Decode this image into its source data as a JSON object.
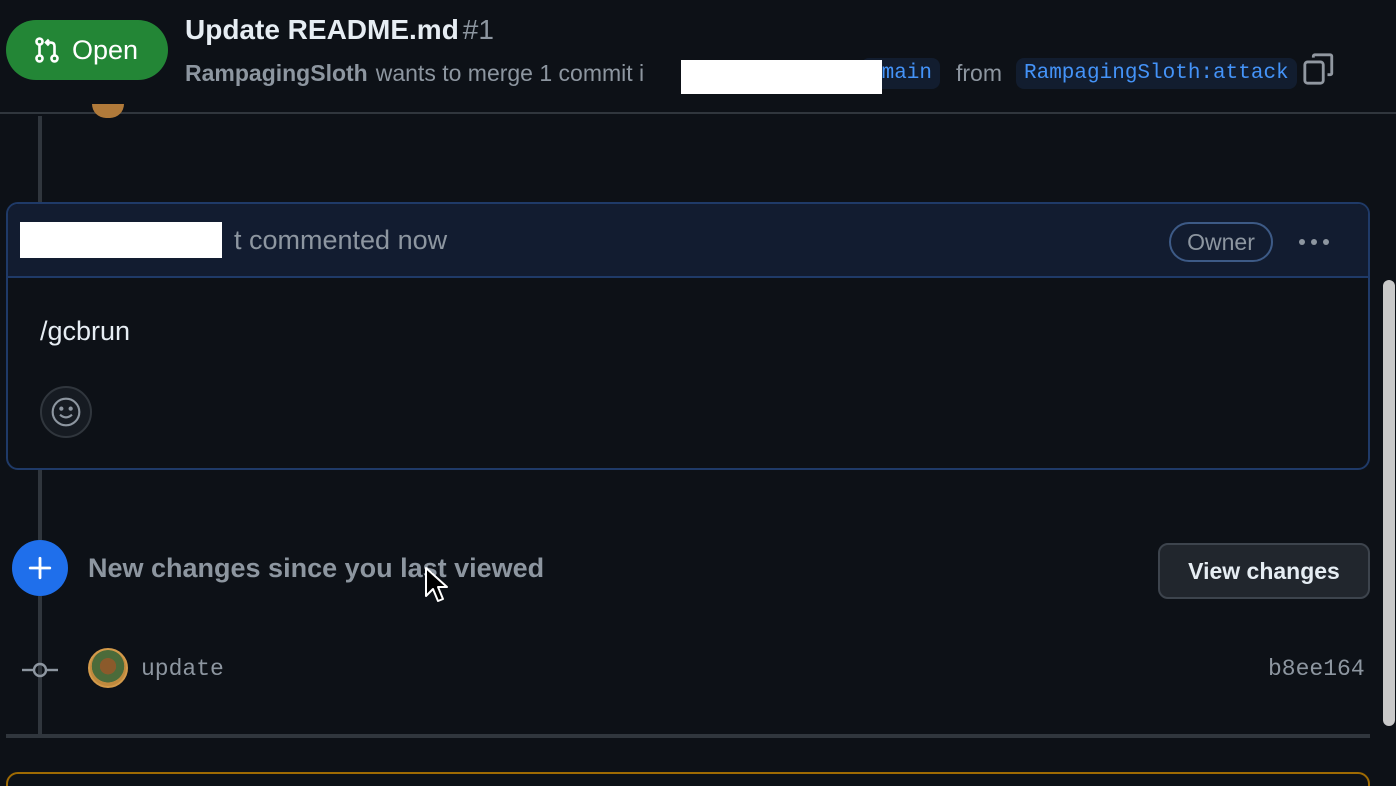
{
  "header": {
    "status": "Open",
    "title": "Update README.md",
    "number": "#1",
    "author": "RampagingSloth",
    "merge_text": "wants to merge 1 commit i",
    "base_branch": ":main",
    "from_text": "from",
    "head_branch": "RampagingSloth:attack"
  },
  "comment": {
    "meta": "t commented now",
    "badge": "Owner",
    "body": "/gcbrun"
  },
  "new_changes": {
    "label": "New changes since you last viewed",
    "button": "View changes"
  },
  "commit": {
    "message": "update",
    "sha": "b8ee164"
  },
  "colors": {
    "open_green": "#238636",
    "accent_blue": "#1f6feb",
    "link_blue": "#4493f8"
  }
}
